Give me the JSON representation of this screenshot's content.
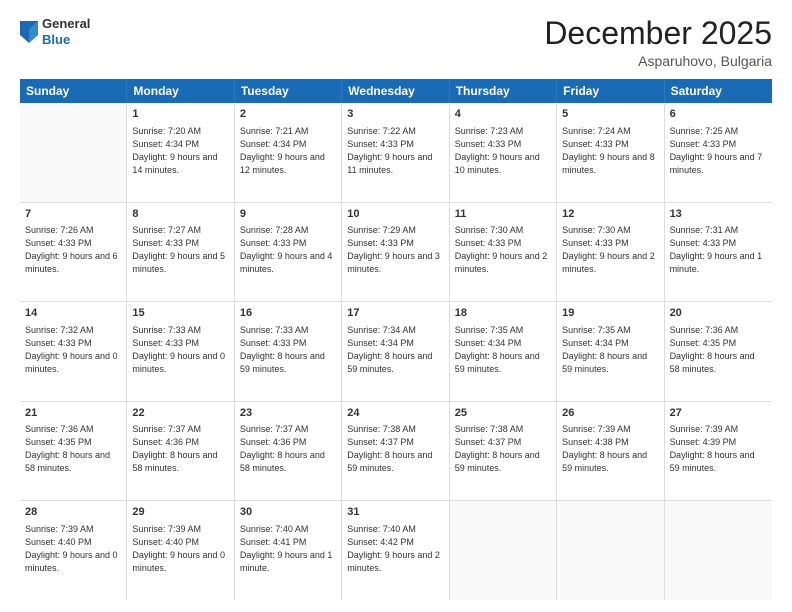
{
  "header": {
    "logo": {
      "general": "General",
      "blue": "Blue"
    },
    "title": "December 2025",
    "subtitle": "Asparuhovo, Bulgaria"
  },
  "calendar": {
    "days": [
      "Sunday",
      "Monday",
      "Tuesday",
      "Wednesday",
      "Thursday",
      "Friday",
      "Saturday"
    ],
    "rows": [
      [
        {
          "day": "",
          "sunrise": "",
          "sunset": "",
          "daylight": "",
          "empty": true
        },
        {
          "day": "1",
          "sunrise": "Sunrise: 7:20 AM",
          "sunset": "Sunset: 4:34 PM",
          "daylight": "Daylight: 9 hours and 14 minutes."
        },
        {
          "day": "2",
          "sunrise": "Sunrise: 7:21 AM",
          "sunset": "Sunset: 4:34 PM",
          "daylight": "Daylight: 9 hours and 12 minutes."
        },
        {
          "day": "3",
          "sunrise": "Sunrise: 7:22 AM",
          "sunset": "Sunset: 4:33 PM",
          "daylight": "Daylight: 9 hours and 11 minutes."
        },
        {
          "day": "4",
          "sunrise": "Sunrise: 7:23 AM",
          "sunset": "Sunset: 4:33 PM",
          "daylight": "Daylight: 9 hours and 10 minutes."
        },
        {
          "day": "5",
          "sunrise": "Sunrise: 7:24 AM",
          "sunset": "Sunset: 4:33 PM",
          "daylight": "Daylight: 9 hours and 8 minutes."
        },
        {
          "day": "6",
          "sunrise": "Sunrise: 7:25 AM",
          "sunset": "Sunset: 4:33 PM",
          "daylight": "Daylight: 9 hours and 7 minutes."
        }
      ],
      [
        {
          "day": "7",
          "sunrise": "Sunrise: 7:26 AM",
          "sunset": "Sunset: 4:33 PM",
          "daylight": "Daylight: 9 hours and 6 minutes."
        },
        {
          "day": "8",
          "sunrise": "Sunrise: 7:27 AM",
          "sunset": "Sunset: 4:33 PM",
          "daylight": "Daylight: 9 hours and 5 minutes."
        },
        {
          "day": "9",
          "sunrise": "Sunrise: 7:28 AM",
          "sunset": "Sunset: 4:33 PM",
          "daylight": "Daylight: 9 hours and 4 minutes."
        },
        {
          "day": "10",
          "sunrise": "Sunrise: 7:29 AM",
          "sunset": "Sunset: 4:33 PM",
          "daylight": "Daylight: 9 hours and 3 minutes."
        },
        {
          "day": "11",
          "sunrise": "Sunrise: 7:30 AM",
          "sunset": "Sunset: 4:33 PM",
          "daylight": "Daylight: 9 hours and 2 minutes."
        },
        {
          "day": "12",
          "sunrise": "Sunrise: 7:30 AM",
          "sunset": "Sunset: 4:33 PM",
          "daylight": "Daylight: 9 hours and 2 minutes."
        },
        {
          "day": "13",
          "sunrise": "Sunrise: 7:31 AM",
          "sunset": "Sunset: 4:33 PM",
          "daylight": "Daylight: 9 hours and 1 minute."
        }
      ],
      [
        {
          "day": "14",
          "sunrise": "Sunrise: 7:32 AM",
          "sunset": "Sunset: 4:33 PM",
          "daylight": "Daylight: 9 hours and 0 minutes."
        },
        {
          "day": "15",
          "sunrise": "Sunrise: 7:33 AM",
          "sunset": "Sunset: 4:33 PM",
          "daylight": "Daylight: 9 hours and 0 minutes."
        },
        {
          "day": "16",
          "sunrise": "Sunrise: 7:33 AM",
          "sunset": "Sunset: 4:33 PM",
          "daylight": "Daylight: 8 hours and 59 minutes."
        },
        {
          "day": "17",
          "sunrise": "Sunrise: 7:34 AM",
          "sunset": "Sunset: 4:34 PM",
          "daylight": "Daylight: 8 hours and 59 minutes."
        },
        {
          "day": "18",
          "sunrise": "Sunrise: 7:35 AM",
          "sunset": "Sunset: 4:34 PM",
          "daylight": "Daylight: 8 hours and 59 minutes."
        },
        {
          "day": "19",
          "sunrise": "Sunrise: 7:35 AM",
          "sunset": "Sunset: 4:34 PM",
          "daylight": "Daylight: 8 hours and 59 minutes."
        },
        {
          "day": "20",
          "sunrise": "Sunrise: 7:36 AM",
          "sunset": "Sunset: 4:35 PM",
          "daylight": "Daylight: 8 hours and 58 minutes."
        }
      ],
      [
        {
          "day": "21",
          "sunrise": "Sunrise: 7:36 AM",
          "sunset": "Sunset: 4:35 PM",
          "daylight": "Daylight: 8 hours and 58 minutes."
        },
        {
          "day": "22",
          "sunrise": "Sunrise: 7:37 AM",
          "sunset": "Sunset: 4:36 PM",
          "daylight": "Daylight: 8 hours and 58 minutes."
        },
        {
          "day": "23",
          "sunrise": "Sunrise: 7:37 AM",
          "sunset": "Sunset: 4:36 PM",
          "daylight": "Daylight: 8 hours and 58 minutes."
        },
        {
          "day": "24",
          "sunrise": "Sunrise: 7:38 AM",
          "sunset": "Sunset: 4:37 PM",
          "daylight": "Daylight: 8 hours and 59 minutes."
        },
        {
          "day": "25",
          "sunrise": "Sunrise: 7:38 AM",
          "sunset": "Sunset: 4:37 PM",
          "daylight": "Daylight: 8 hours and 59 minutes."
        },
        {
          "day": "26",
          "sunrise": "Sunrise: 7:39 AM",
          "sunset": "Sunset: 4:38 PM",
          "daylight": "Daylight: 8 hours and 59 minutes."
        },
        {
          "day": "27",
          "sunrise": "Sunrise: 7:39 AM",
          "sunset": "Sunset: 4:39 PM",
          "daylight": "Daylight: 8 hours and 59 minutes."
        }
      ],
      [
        {
          "day": "28",
          "sunrise": "Sunrise: 7:39 AM",
          "sunset": "Sunset: 4:40 PM",
          "daylight": "Daylight: 9 hours and 0 minutes."
        },
        {
          "day": "29",
          "sunrise": "Sunrise: 7:39 AM",
          "sunset": "Sunset: 4:40 PM",
          "daylight": "Daylight: 9 hours and 0 minutes."
        },
        {
          "day": "30",
          "sunrise": "Sunrise: 7:40 AM",
          "sunset": "Sunset: 4:41 PM",
          "daylight": "Daylight: 9 hours and 1 minute."
        },
        {
          "day": "31",
          "sunrise": "Sunrise: 7:40 AM",
          "sunset": "Sunset: 4:42 PM",
          "daylight": "Daylight: 9 hours and 2 minutes."
        },
        {
          "day": "",
          "sunrise": "",
          "sunset": "",
          "daylight": "",
          "empty": true
        },
        {
          "day": "",
          "sunrise": "",
          "sunset": "",
          "daylight": "",
          "empty": true
        },
        {
          "day": "",
          "sunrise": "",
          "sunset": "",
          "daylight": "",
          "empty": true
        }
      ]
    ]
  }
}
